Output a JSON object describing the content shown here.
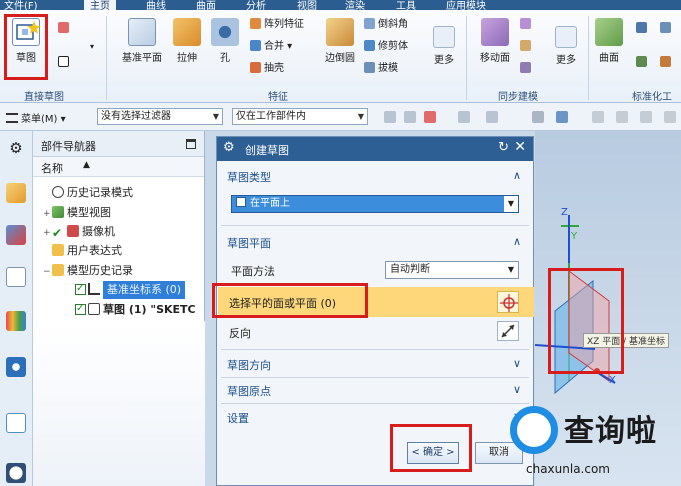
{
  "menubar": {
    "tabs": [
      "文件(F)",
      "主页",
      "曲线",
      "曲面",
      "分析",
      "视图",
      "渲染",
      "工具",
      "应用模块"
    ]
  },
  "ribbon": {
    "groups": {
      "direct_sketch": "直接草图",
      "feature": "特征",
      "sync_modeling": "同步建模",
      "standard_parts": "标准化工具"
    },
    "buttons": {
      "sketch": "草图",
      "datum_plane": "基准平面",
      "extrude": "拉伸",
      "hole": "孔",
      "pattern_feature": "阵列特征",
      "unite": "合并",
      "shell": "抽壳",
      "edge_blend": "边倒圆",
      "chamfer": "倒斜角",
      "trim_body": "修剪体",
      "draft": "拔模",
      "more_feature": "更多",
      "move_face": "移动面",
      "more_sync": "更多",
      "surface": "曲面"
    }
  },
  "toolbar2": {
    "menu": "菜单(M)",
    "filter": "没有选择过滤器",
    "scope": "仅在工作部件内"
  },
  "navigator": {
    "title": "部件导航器",
    "column": "名称",
    "items": {
      "history_mode": "历史记录模式",
      "model_views": "模型视图",
      "cameras": "摄像机",
      "user_expressions": "用户表达式",
      "model_history": "模型历史记录",
      "datum_csys": "基准坐标系 (0)",
      "sketch": "草图 (1) \"SKETC"
    }
  },
  "dialog": {
    "title": "创建草图",
    "sketch_type": {
      "header": "草图类型",
      "value": "在平面上"
    },
    "sketch_plane": {
      "header": "草图平面",
      "method_label": "平面方法",
      "method_value": "自动判断",
      "select_label": "选择平的面或平面 (0)",
      "reverse_label": "反向"
    },
    "sketch_orientation": "草图方向",
    "sketch_origin": "草图原点",
    "settings": "设置",
    "ok": "< 确定 >",
    "cancel": "取消"
  },
  "viewport": {
    "axis_z": "Z",
    "axis_y": "Y",
    "axis_x": "X",
    "tooltip": "XZ 平面 / 基准坐标"
  },
  "watermark": {
    "brand": "查询啦",
    "url": "chaxunla.com"
  },
  "colors": {
    "title_blue": "#2d5f95",
    "highlight_yellow": "#fdd779",
    "selection_blue": "#2f7fd8",
    "annotation_red": "#d81b1b"
  }
}
